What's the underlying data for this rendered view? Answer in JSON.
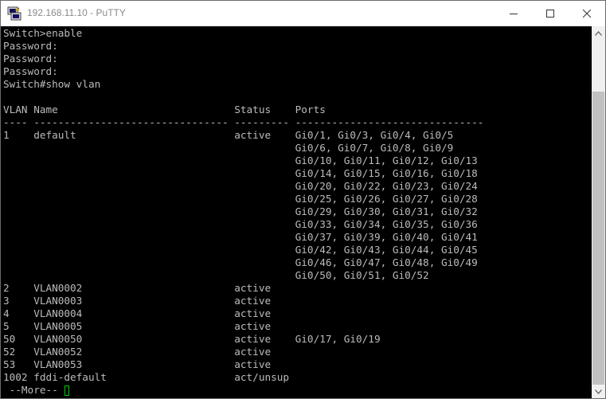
{
  "window": {
    "title": "192.168.11.10 - PuTTY",
    "controls": {
      "minimize": "minimize-icon",
      "maximize": "maximize-icon",
      "close": "close-icon"
    }
  },
  "terminal": {
    "lines": [
      "Switch>enable",
      "Password:",
      "Password:",
      "Password:",
      "Switch#show vlan",
      "",
      "VLAN Name                             Status    Ports",
      "---- -------------------------------- --------- -------------------------------",
      "1    default                          active    Gi0/1, Gi0/3, Gi0/4, Gi0/5",
      "                                                Gi0/6, Gi0/7, Gi0/8, Gi0/9",
      "                                                Gi0/10, Gi0/11, Gi0/12, Gi0/13",
      "                                                Gi0/14, Gi0/15, Gi0/16, Gi0/18",
      "                                                Gi0/20, Gi0/22, Gi0/23, Gi0/24",
      "                                                Gi0/25, Gi0/26, Gi0/27, Gi0/28",
      "                                                Gi0/29, Gi0/30, Gi0/31, Gi0/32",
      "                                                Gi0/33, Gi0/34, Gi0/35, Gi0/36",
      "                                                Gi0/37, Gi0/39, Gi0/40, Gi0/41",
      "                                                Gi0/42, Gi0/43, Gi0/44, Gi0/45",
      "                                                Gi0/46, Gi0/47, Gi0/48, Gi0/49",
      "                                                Gi0/50, Gi0/51, Gi0/52",
      "2    VLAN0002                         active",
      "3    VLAN0003                         active",
      "4    VLAN0004                         active",
      "5    VLAN0005                         active",
      "50   VLAN0050                         active    Gi0/17, Gi0/19",
      "52   VLAN0052                         active",
      "53   VLAN0053                         active",
      "1002 fddi-default                     act/unsup"
    ],
    "more_prompt": " --More--",
    "colors": {
      "background": "#000000",
      "text": "#bbbbbb",
      "cursor": "#00d000"
    }
  },
  "scrollbar": {
    "up": "scroll-up-arrow-icon",
    "down": "scroll-down-arrow-icon"
  }
}
